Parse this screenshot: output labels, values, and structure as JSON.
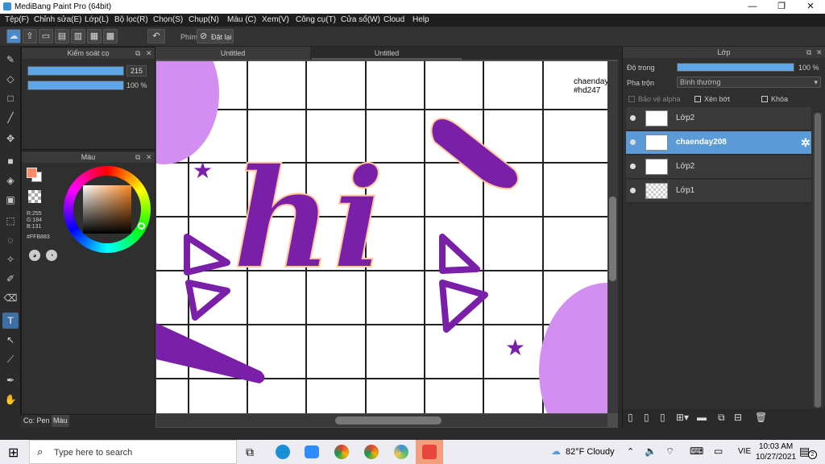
{
  "app": {
    "title": "MediBang Paint Pro (64bit)"
  },
  "menu": [
    "Tệp(F)",
    "Chỉnh sửa(E)",
    "Lớp(L)",
    "Bộ lọc(R)",
    "Chọn(S)",
    "Chụp(N)",
    "Màu (C)",
    "Xem(V)",
    "Công cụ(T)",
    "Cửa sổ(W)",
    "Cloud",
    "Help"
  ],
  "toolbar": {
    "phim_label": "Phím",
    "reset_label": "Đặt lại"
  },
  "brush_panel": {
    "title": "Kiểm soát cọ",
    "size_value": "215",
    "opacity_value": "100 %"
  },
  "color_panel": {
    "title": "Màu",
    "r": "R:255",
    "g": "G:184",
    "b": "B:131",
    "hex": "#FFB883",
    "primary_color": "#FF8A6A"
  },
  "left_tabs": {
    "pen_tab": "Cọ: Pen",
    "color_tab": "Màu"
  },
  "doc_tabs": [
    "Untitled",
    "Untitled"
  ],
  "canvas": {
    "signature_line1": "chaenday",
    "signature_line2": "#hd247",
    "artwork_word": "hi"
  },
  "layer_panel": {
    "title": "Lớp",
    "opacity_label": "Độ trong",
    "opacity_value": "100 %",
    "blend_label": "Pha trộn",
    "blend_value": "Bình thường",
    "protect_alpha": "Bảo vệ alpha",
    "clip": "Xén bớt",
    "lock": "Khóa",
    "layers": [
      {
        "name": "Lớp2"
      },
      {
        "name": "chaenday208"
      },
      {
        "name": "Lớp2"
      },
      {
        "name": "Lớp1"
      }
    ]
  },
  "taskbar": {
    "search_placeholder": "Type here to search",
    "weather": "82°F  Cloudy",
    "lang": "VIE",
    "time": "10:03 AM",
    "date": "10/27/2021",
    "notif_count": "2"
  }
}
